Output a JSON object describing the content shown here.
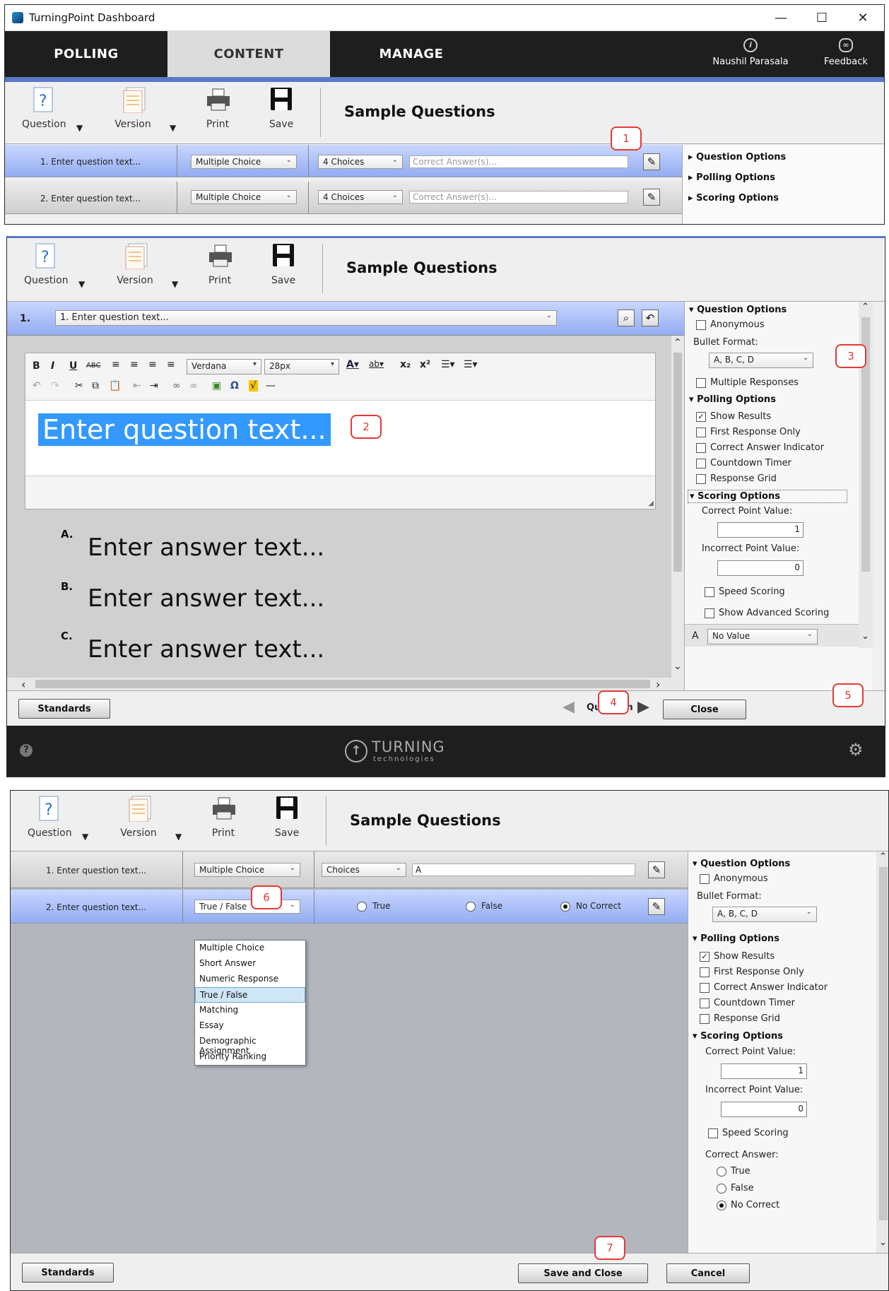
{
  "app": {
    "title": "TurningPoint Dashboard"
  },
  "nav": {
    "tabs": [
      {
        "label": "POLLING"
      },
      {
        "label": "CONTENT"
      },
      {
        "label": "MANAGE"
      }
    ],
    "user": "Naushil Parasala",
    "feedback": "Feedback"
  },
  "toolbar": {
    "question": "Question",
    "version": "Version",
    "print": "Print",
    "save": "Save",
    "title": "Sample Questions"
  },
  "panel1": {
    "rows": [
      {
        "text": "1. Enter question text...",
        "type": "Multiple Choice",
        "choices": "4 Choices",
        "answer_placeholder": "Correct Answer(s)..."
      },
      {
        "text": "2. Enter question text...",
        "type": "Multiple Choice",
        "choices": "4 Choices",
        "answer_placeholder": "Correct Answer(s)..."
      }
    ],
    "sections": [
      "Question Options",
      "Polling Options",
      "Scoring Options"
    ]
  },
  "panel2": {
    "qnum": "1.",
    "qselect": "1. Enter question text...",
    "font": "Verdana",
    "size": "28px",
    "question_text": "Enter question text...",
    "answers": [
      {
        "letter": "A.",
        "text": "Enter answer text..."
      },
      {
        "letter": "B.",
        "text": "Enter answer text..."
      },
      {
        "letter": "C.",
        "text": "Enter answer text..."
      }
    ],
    "options": {
      "question_options": "Question Options",
      "anonymous": "Anonymous",
      "bullet_format_label": "Bullet Format:",
      "bullet_format": "A, B, C, D",
      "multiple_responses": "Multiple Responses",
      "polling_options": "Polling Options",
      "show_results": "Show Results",
      "first_response_only": "First Response Only",
      "correct_answer_indicator": "Correct Answer Indicator",
      "countdown_timer": "Countdown Timer",
      "response_grid": "Response Grid",
      "scoring_options": "Scoring Options",
      "correct_point_label": "Correct Point Value:",
      "correct_point": "1",
      "incorrect_point_label": "Incorrect Point Value:",
      "incorrect_point": "0",
      "speed_scoring": "Speed Scoring",
      "show_advanced_scoring": "Show Advanced Scoring",
      "a_label": "A",
      "a_value": "No Value"
    },
    "footer": {
      "standards": "Standards",
      "question": "Question",
      "close": "Close",
      "brand": "TURNING",
      "brand_sub": "technologies"
    }
  },
  "panel3": {
    "rows": [
      {
        "text": "1. Enter question text...",
        "type": "Multiple Choice",
        "choices": "Choices",
        "answer": "A"
      },
      {
        "text": "2. Enter question text...",
        "type": "True / False",
        "opt_true": "True",
        "opt_false": "False",
        "opt_none": "No Correct"
      }
    ],
    "menu": [
      "Multiple Choice",
      "Short Answer",
      "Numeric Response",
      "True / False",
      "Matching",
      "Essay",
      "Demographic Assignment",
      "Priority Ranking"
    ],
    "options": {
      "question_options": "Question Options",
      "anonymous": "Anonymous",
      "bullet_format_label": "Bullet Format:",
      "bullet_format": "A, B, C, D",
      "polling_options": "Polling Options",
      "show_results": "Show Results",
      "first_response_only": "First Response Only",
      "correct_answer_indicator": "Correct Answer Indicator",
      "countdown_timer": "Countdown Timer",
      "response_grid": "Response Grid",
      "scoring_options": "Scoring Options",
      "correct_point_label": "Correct Point Value:",
      "correct_point": "1",
      "incorrect_point_label": "Incorrect Point Value:",
      "incorrect_point": "0",
      "speed_scoring": "Speed Scoring",
      "correct_answer_label": "Correct Answer:",
      "ca_true": "True",
      "ca_false": "False",
      "ca_none": "No Correct"
    },
    "footer": {
      "standards": "Standards",
      "save_close": "Save and Close",
      "cancel": "Cancel"
    }
  },
  "callouts": [
    "1",
    "2",
    "3",
    "4",
    "5",
    "6",
    "7"
  ],
  "colors": {
    "nav_bg": "#1e1e1e",
    "selected_row": "#93acf2",
    "highlight": "#3399ff",
    "callout": "#e53935"
  }
}
